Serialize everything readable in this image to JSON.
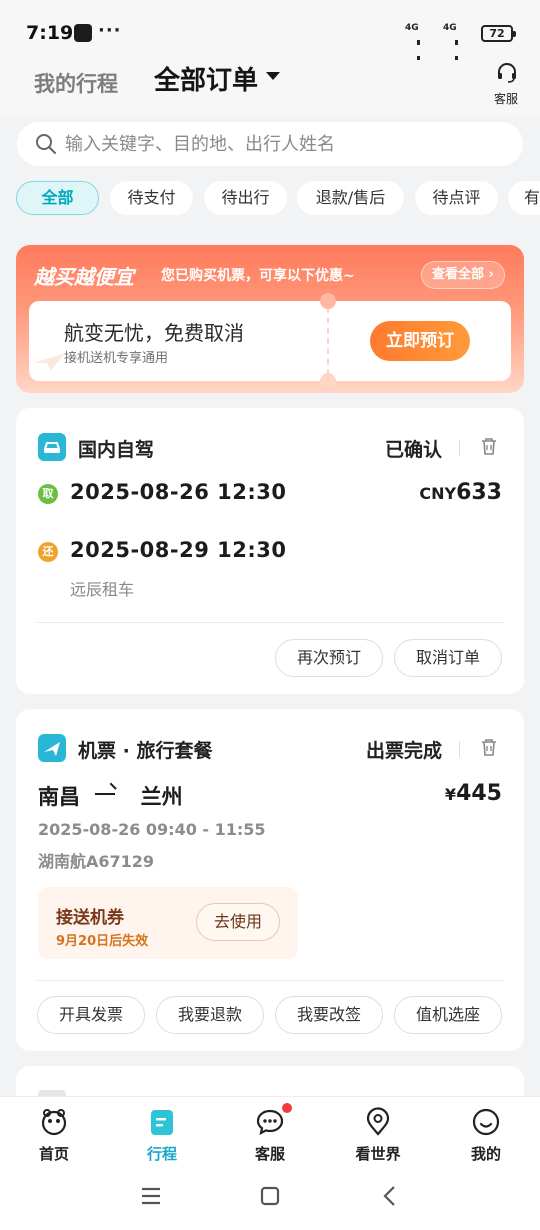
{
  "status_bar": {
    "time": "7:19",
    "more": "···",
    "net1": "4G",
    "net2": "4G",
    "battery": "72"
  },
  "header": {
    "my_trips": "我的行程",
    "all_orders": "全部订单",
    "customer_service": "客服"
  },
  "search": {
    "placeholder": "输入关键字、目的地、出行人姓名"
  },
  "filters": [
    "全部",
    "待支付",
    "待出行",
    "退款/售后",
    "待点评",
    "有"
  ],
  "promo": {
    "title": "越买越便宜",
    "subtitle": "您已购买机票，可享以下优惠~",
    "view_all": "查看全部",
    "headline": "航变无忧，免费取消",
    "desc": "接机送机专享通用",
    "book_button": "立即预订"
  },
  "order1": {
    "category": "国内自驾",
    "status": "已确认",
    "pickup_tag": "取",
    "pickup_time": "2025-08-26 12:30",
    "return_tag": "还",
    "return_time": "2025-08-29 12:30",
    "company": "远辰租车",
    "price_currency": "CNY",
    "price_amount": "633",
    "btn_rebook": "再次预订",
    "btn_cancel": "取消订单"
  },
  "order2": {
    "category": "机票 · 旅行套餐",
    "status": "出票完成",
    "from": "南昌",
    "to": "兰州",
    "price_currency": "¥",
    "price_amount": "445",
    "time": "2025-08-26 09:40 - 11:55",
    "flight": "湖南航A67129",
    "coupon_title": "接送机券",
    "coupon_expiry": "9月20日后失效",
    "coupon_button": "去使用",
    "actions": [
      "开具发票",
      "我要退款",
      "我要改签",
      "值机选座"
    ]
  },
  "tabs": [
    {
      "label": "首页",
      "icon": "home-icon"
    },
    {
      "label": "行程",
      "icon": "trip-icon"
    },
    {
      "label": "客服",
      "icon": "chat-icon"
    },
    {
      "label": "看世界",
      "icon": "location-icon"
    },
    {
      "label": "我的",
      "icon": "smile-icon"
    }
  ],
  "colors": {
    "accent": "#1aa8c4",
    "promo": "#ff7a5c",
    "button_orange": "#ff8a34"
  }
}
